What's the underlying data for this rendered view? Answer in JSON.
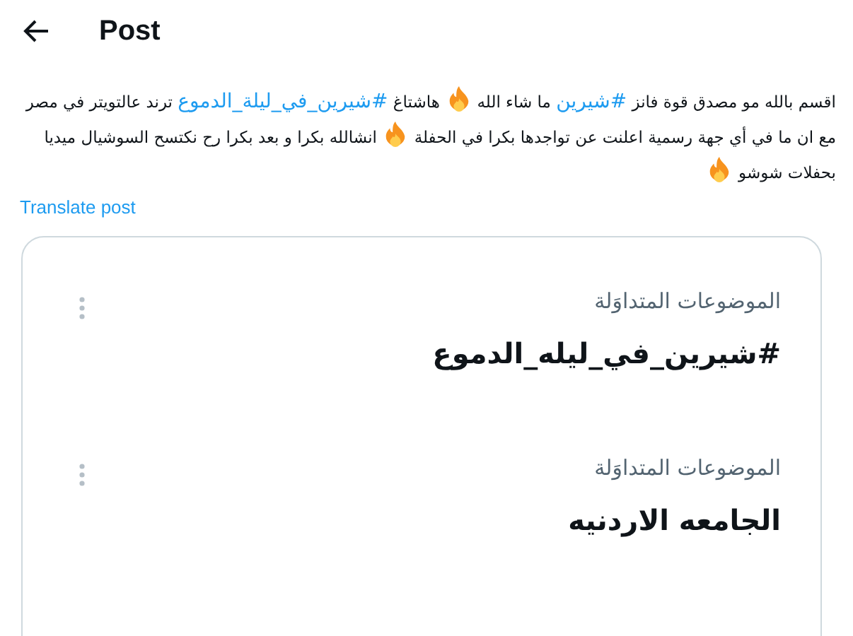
{
  "header": {
    "title": "Post"
  },
  "post": {
    "segments": [
      {
        "kind": "text",
        "text": "اقسم بالله مو مصدق قوة فانز "
      },
      {
        "kind": "hashtag",
        "text": "#شيرين"
      },
      {
        "kind": "text",
        "text": " ما شاء الله "
      },
      {
        "kind": "fire"
      },
      {
        "kind": "text",
        "text": " هاشتاغ "
      },
      {
        "kind": "hashtag",
        "text": "#شيرين_في_ليلة_الدموع"
      },
      {
        "kind": "text",
        "text": " ترند عالتويتر في مصر مع ان ما في أي جهة رسمية اعلنت عن تواجدها بكرا في الحفلة "
      },
      {
        "kind": "fire"
      },
      {
        "kind": "text",
        "text": " انشالله بكرا و بعد بكرا رح نكتسح السوشيال ميديا بحفلات شوشو "
      },
      {
        "kind": "fire"
      }
    ],
    "translate": "Translate post"
  },
  "trends": [
    {
      "label": "الموضوعات المتداوَلة",
      "title": "#شيرين_في_ليله_الدموع"
    },
    {
      "label": "الموضوعات المتداوَلة",
      "title": "الجامعه الاردنيه"
    }
  ]
}
